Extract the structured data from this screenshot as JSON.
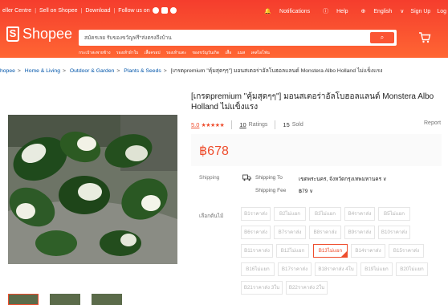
{
  "topbar": {
    "seller_centre": "eller Centre",
    "sell": "Sell on Shopee",
    "download": "Download",
    "follow": "Follow us on",
    "notifications": "Notifications",
    "help": "Help",
    "language": "English",
    "signup": "Sign Up",
    "login": "Log"
  },
  "header": {
    "logo_text": "Shopee",
    "search_value": "สมัครเลย รับของขวัญฟรี*ส่งตรงถึงบ้าน",
    "suggestions": [
      "กระเป๋าสะพายข้าง",
      "รองเท้าผ้าใบ",
      "เสื้อครอป",
      "รองเท้าแตะ",
      "ของขวัญวันเกิด",
      "เสื้อ",
      "แมส",
      "เคสไอโฟน"
    ]
  },
  "breadcrumb": {
    "items": [
      "hopee",
      "Home & Living",
      "Outdoor & Garden",
      "Plants & Seeds"
    ],
    "current": "[เกรดpremium \"คุ้มสุดๆๆ\"] มอนสเตอร่าอัลโบฮอลแลนด์ Monstera Albo Holland ไม่แข็งแรง"
  },
  "product": {
    "title": "[เกรดpremium \"คุ้มสุดๆๆ\"] มอนสเตอร่าอัลโบฮอลแลนด์ Monstera Albo Holland ไม่แข็งแรง",
    "rating": "5.0",
    "stars": "★★★★★",
    "ratings_count": "10",
    "ratings_label": "Ratings",
    "sold_count": "15",
    "sold_label": "Sold",
    "report": "Report",
    "price": "฿678"
  },
  "shipping": {
    "label": "Shipping",
    "to_label": "Shipping To",
    "to_value": "เขตพระนคร, จังหวัดกรุงเทพมหานคร",
    "fee_label": "Shipping Fee",
    "fee_value": "฿79"
  },
  "variations": {
    "label": "เลือกต้นไม้",
    "options": [
      "B1ราคาส่ง",
      "B2ไม่แยก",
      "B3ไม่แยก",
      "B4ราคาส่ง",
      "B5ไม่แยก",
      "B6ราคาส่ง",
      "B7ราคาส่ง",
      "B8ราคาส่ง",
      "B9ราคาส่ง",
      "B10ราคาส่ง",
      "B11ราคาส่ง",
      "B12ไม่แยก",
      "B13ไม่แยก",
      "B14ราคาส่ง",
      "B15ราคาส่ง",
      "B16ไม่แยก",
      "B17ราคาส่ง",
      "B18ราคาส่ง 4ใบ",
      "B19ไม่แยก",
      "B20ไม่แยก",
      "B21ราคาส่ง 3ใบ",
      "B22ราคาส่ง 2ใบ"
    ],
    "selected": "B13ไม่แยก"
  },
  "colors": {
    "brand": "#ee4d2d",
    "header": "#f53d2d"
  }
}
